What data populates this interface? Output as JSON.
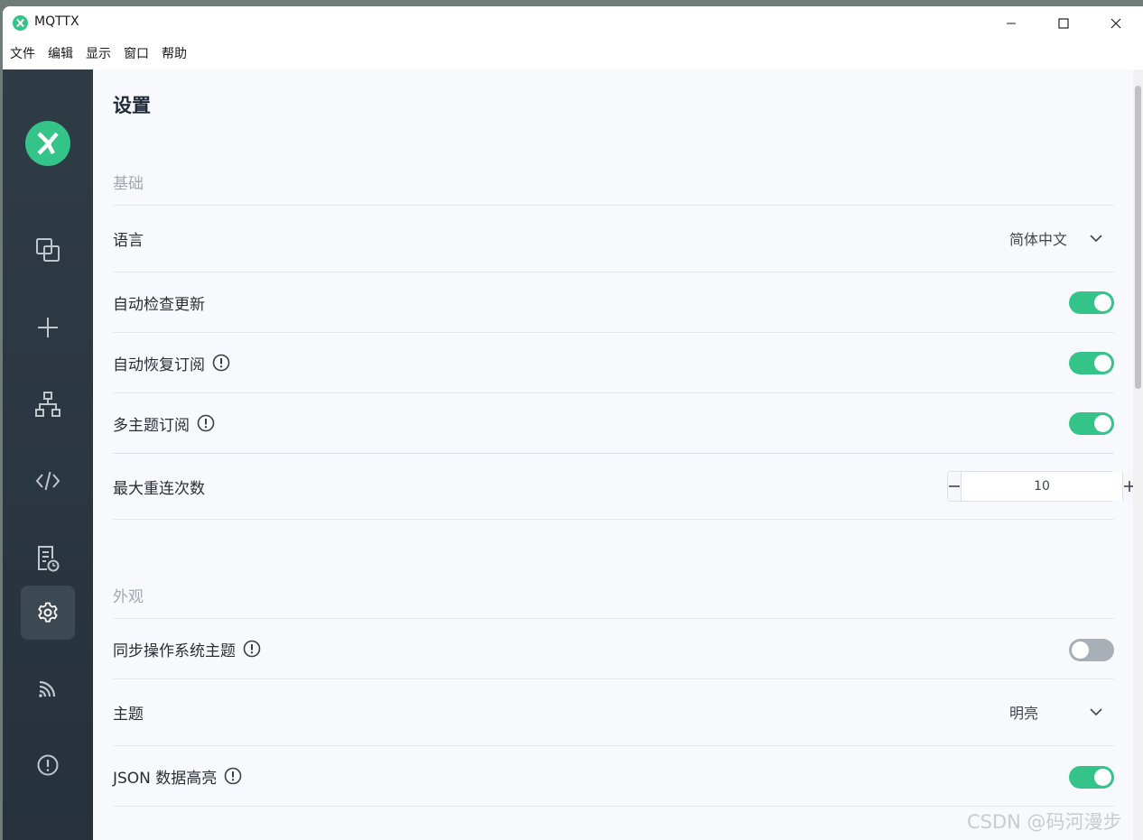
{
  "app": {
    "title": "MQTTX"
  },
  "menu": [
    "文件",
    "编辑",
    "显示",
    "窗口",
    "帮助"
  ],
  "sidebar": {
    "items": [
      {
        "name": "connections",
        "icon": "copy-icon"
      },
      {
        "name": "new",
        "icon": "plus-icon"
      },
      {
        "name": "topology",
        "icon": "sitemap-icon"
      },
      {
        "name": "script",
        "icon": "code-icon"
      },
      {
        "name": "log",
        "icon": "log-icon"
      },
      {
        "name": "settings",
        "icon": "gear-icon",
        "active": true
      },
      {
        "name": "subscriptions",
        "icon": "feed-icon"
      },
      {
        "name": "about",
        "icon": "info-icon"
      }
    ]
  },
  "page": {
    "title": "设置",
    "basic": {
      "heading": "基础",
      "language": {
        "label": "语言",
        "value": "简体中文"
      },
      "auto_check": {
        "label": "自动检查更新",
        "on": true
      },
      "auto_resub": {
        "label": "自动恢复订阅",
        "on": true
      },
      "multi_topic": {
        "label": "多主题订阅",
        "on": true
      },
      "max_reconnect": {
        "label": "最大重连次数",
        "value": "10"
      }
    },
    "appearance": {
      "heading": "外观",
      "sync_os_theme": {
        "label": "同步操作系统主题",
        "on": false
      },
      "theme": {
        "label": "主题",
        "value": "明亮"
      },
      "json_highlight": {
        "label": "JSON 数据高亮",
        "on": true
      }
    }
  },
  "watermark": "CSDN @码河漫步",
  "colors": {
    "accent": "#34c388",
    "sidebar": "#2b3640",
    "toggle_off": "#a9afb7"
  }
}
